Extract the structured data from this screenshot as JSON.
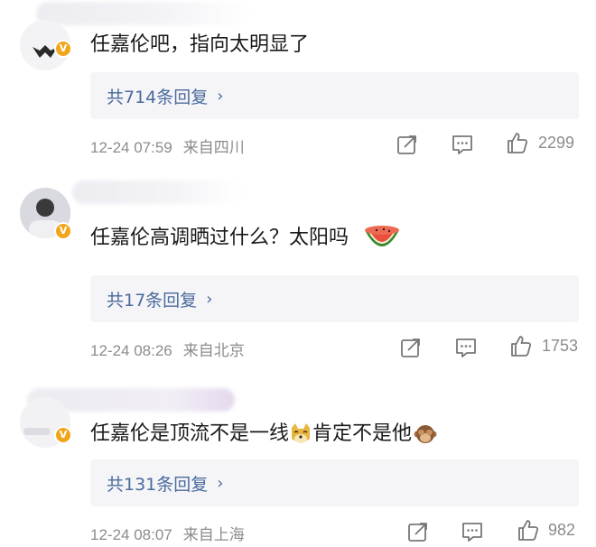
{
  "comments": [
    {
      "text": "任嘉伦吧，指向太明显了",
      "replies": "共714条回复",
      "time": "12-24 07:59",
      "location": "来自四川",
      "likes": "2299"
    },
    {
      "text": "任嘉伦高调晒过什么？太阳吗",
      "replies": "共17条回复",
      "time": "12-24 08:26",
      "location": "来自北京",
      "likes": "1753"
    },
    {
      "text": "任嘉伦是顶流不是一线",
      "text2": "肯定不是他",
      "replies": "共131条回复",
      "time": "12-24 08:07",
      "location": "来自上海",
      "likes": "982"
    }
  ],
  "icons": {
    "share": "share-icon",
    "comment": "comment-icon",
    "like": "thumbs-up-icon",
    "verified": "verified-badge-icon",
    "watermelon": "watermelon-emoji",
    "doge": "doge-emoji",
    "monkey": "see-no-evil-monkey-emoji"
  },
  "colors": {
    "reply_link": "#4a6a9e",
    "meta_gray": "#8c8c8c",
    "reply_bg": "#f5f5f7",
    "badge": "#f2a51a"
  }
}
